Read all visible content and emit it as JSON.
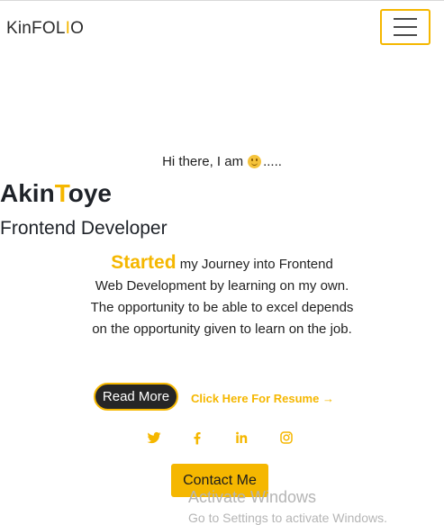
{
  "navbar": {
    "brand_prefix": "KinFOL",
    "brand_accent": "I",
    "brand_suffix": "O",
    "menu_icon": "hamburger-icon"
  },
  "hero": {
    "greeting": "Hi there, I am",
    "greeting_suffix": ".....",
    "greeting_emoji": "smiley-icon",
    "name_first": "Akin",
    "name_accent": "T",
    "name_rest": "oye",
    "role": "Frontend Developer",
    "intro_highlight": "Started",
    "intro_line1": " my Journey into Frontend",
    "intro_rest": "Web Development by learning on my own. The opportunity to be able to excel depends on the opportunity given to learn on the job.",
    "read_more_label": "Read More",
    "resume_label": "Click Here For Resume",
    "resume_arrow": "→",
    "contact_label": "Contact Me"
  },
  "socials": [
    "twitter-icon",
    "facebook-icon",
    "linkedin-icon",
    "instagram-icon"
  ],
  "watermark": {
    "title": "Activate Windows",
    "subtitle": "Go to Settings to activate Windows."
  },
  "colors": {
    "accent": "#f5b700",
    "dark": "#262626",
    "text": "#212529"
  }
}
